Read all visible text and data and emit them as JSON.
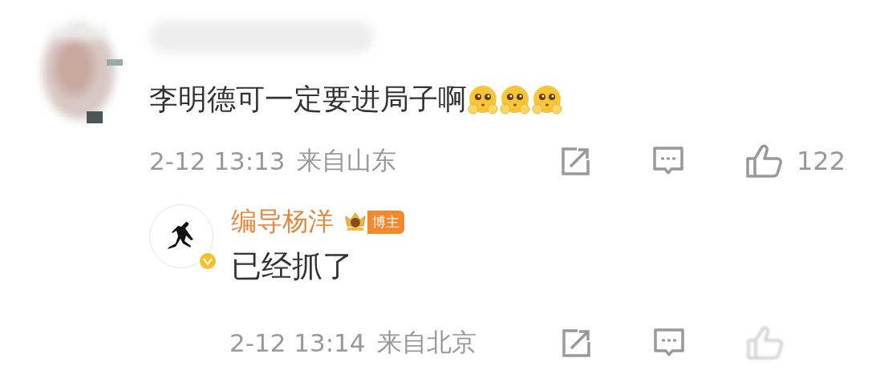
{
  "comment": {
    "text": "李明德可一定要进局子啊",
    "time": "2-12 13:13",
    "location": "来自山东",
    "likes": "122"
  },
  "reply": {
    "author": "编导杨洋",
    "badge": "博主",
    "verified": true,
    "text": "已经抓了",
    "time": "2-12 13:14",
    "location": "来自北京"
  }
}
